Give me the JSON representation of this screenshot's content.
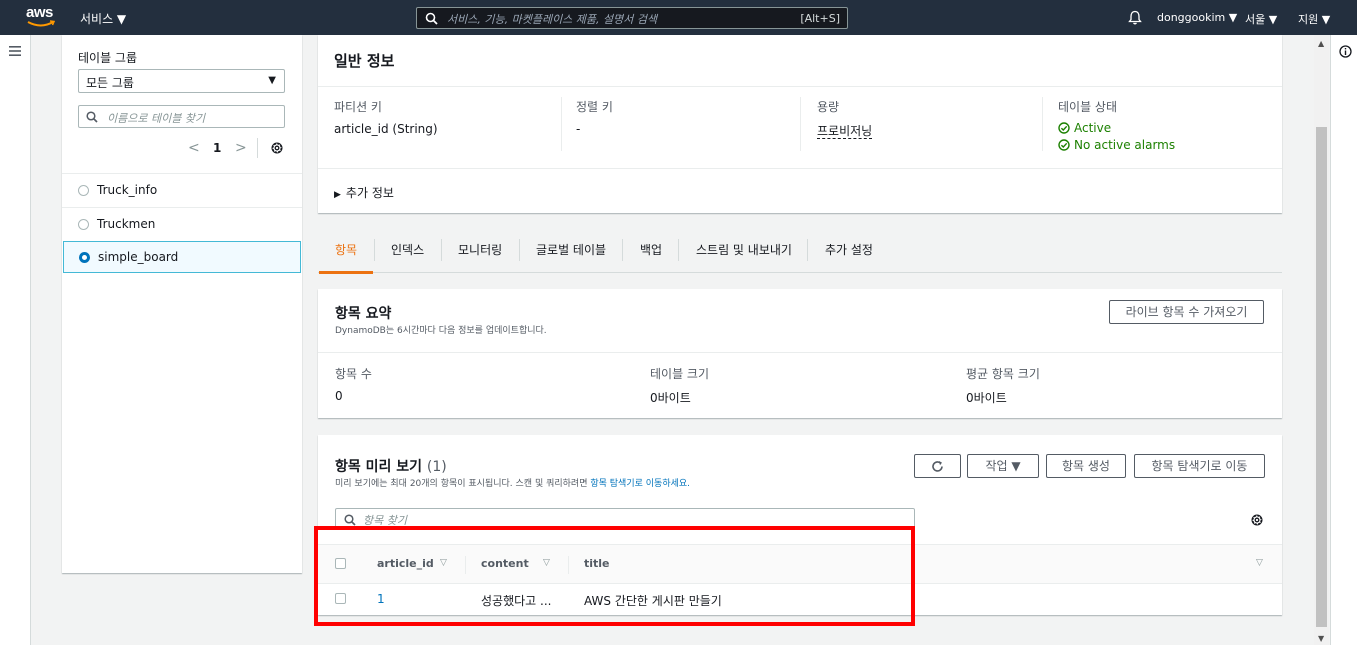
{
  "topnav": {
    "logo_text": "aws",
    "services_label": "서비스 ▼",
    "search_placeholder": "서비스, 기능, 마켓플레이스 제품, 설명서 검색",
    "search_shortcut": "[Alt+S]",
    "user_label": "donggookim ▼",
    "region_label": "서울 ▼",
    "support_label": "지원 ▼",
    "bg_color": "#232f3e"
  },
  "left_panel": {
    "group_label": "테이블 그룹",
    "group_select_value": "모든 그룹",
    "table_search_placeholder": "이름으로 테이블 찾기",
    "page_number": "1",
    "tables": [
      {
        "name": "Truck_info",
        "selected": false
      },
      {
        "name": "Truckmen",
        "selected": false
      },
      {
        "name": "simple_board",
        "selected": true
      }
    ]
  },
  "general_info": {
    "title": "일반 정보",
    "partition_key_label": "파티션 키",
    "partition_key_value": "article_id (String)",
    "sort_key_label": "정렬 키",
    "sort_key_value": "-",
    "capacity_label": "용량",
    "capacity_value": "프로비저닝",
    "table_status_label": "테이블 상태",
    "status_active": "Active",
    "status_alarms": "No active alarms",
    "more_info_label": "추가 정보",
    "status_color": "#1d8102"
  },
  "tabs": [
    {
      "label": "항목",
      "active": true
    },
    {
      "label": "인덱스",
      "active": false
    },
    {
      "label": "모니터링",
      "active": false
    },
    {
      "label": "글로벌 테이블",
      "active": false
    },
    {
      "label": "백업",
      "active": false
    },
    {
      "label": "스트림 및 내보내기",
      "active": false
    },
    {
      "label": "추가 설정",
      "active": false
    }
  ],
  "summary": {
    "title": "항목 요약",
    "subtitle": "DynamoDB는 6시간마다 다음 정보를 업데이트합니다.",
    "live_count_button": "라이브 항목 수 가져오기",
    "item_count_label": "항목 수",
    "item_count_value": "0",
    "table_size_label": "테이블 크기",
    "table_size_value": "0바이트",
    "avg_item_size_label": "평균 항목 크기",
    "avg_item_size_value": "0바이트"
  },
  "preview": {
    "title": "항목 미리 보기",
    "count": "(1)",
    "subtitle": "미리 보기에는 최대 20개의 항목이 표시됩니다. 스캔 및 쿼리하려면",
    "subtitle_link": "항목 탐색기로 이동하세요.",
    "actions_button": "작업 ▼",
    "create_button": "항목 생성",
    "explorer_button": "항목 탐색기로 이동",
    "search_placeholder": "항목 찾기",
    "columns": [
      "article_id",
      "content",
      "title"
    ],
    "rows": [
      {
        "article_id": "1",
        "content": "성공했다고 ...",
        "title": "AWS 간단한 게시판 만들기"
      }
    ]
  },
  "colors": {
    "accent": "#ec7211",
    "link": "#0073bb",
    "highlight": "#ff0000"
  }
}
